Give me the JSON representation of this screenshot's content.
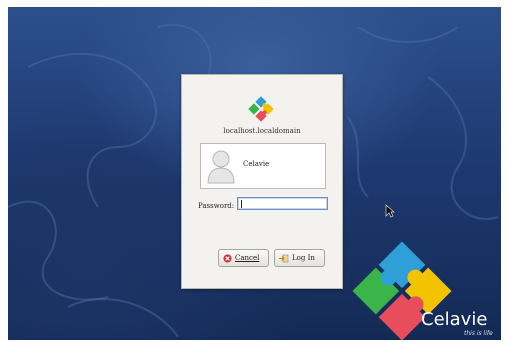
{
  "login": {
    "hostname": "localhost.localdomain",
    "user": "Celavie",
    "password_label": "Password:",
    "password_value": "",
    "cancel_label": "Cancel",
    "login_label": "Log In"
  },
  "branding": {
    "name": "Celavie",
    "tagline": "this is life"
  },
  "colors": {
    "bg_top": "#2c4f8c",
    "bg_bottom": "#142a55",
    "puzzle_green": "#3bb54a",
    "puzzle_blue": "#2f9fd8",
    "puzzle_yellow": "#f4c300",
    "puzzle_red": "#e84d5b"
  }
}
